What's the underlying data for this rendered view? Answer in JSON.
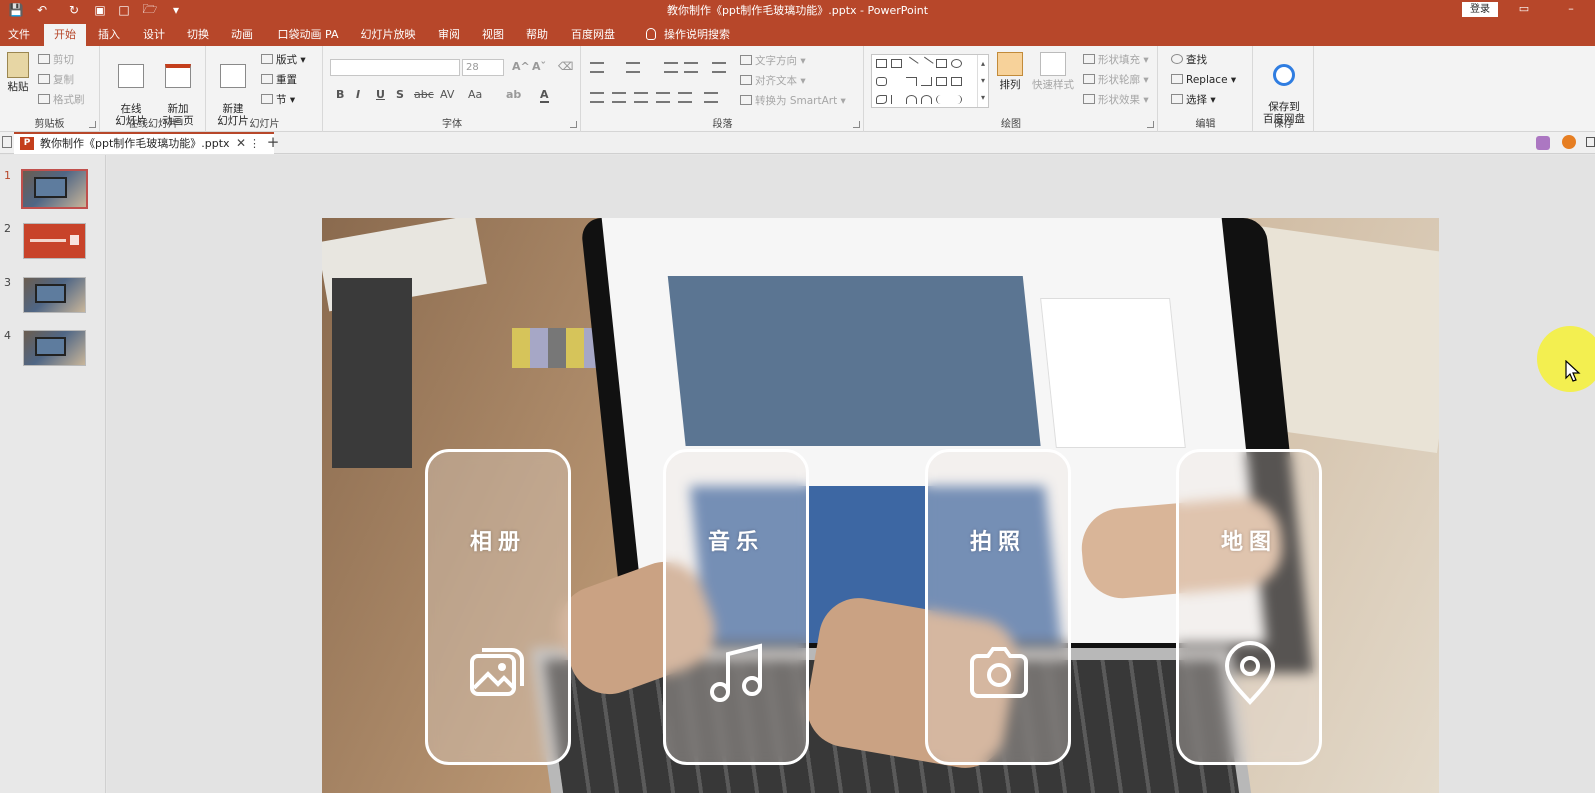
{
  "app": {
    "window_title": "教你制作《ppt制作毛玻璃功能》.pptx  -  PowerPoint",
    "login_label": "登录",
    "file_tab_label": "教你制作《ppt制作毛玻璃功能》.pptx"
  },
  "menu_tabs": [
    "文件",
    "开始",
    "插入",
    "设计",
    "切换",
    "动画",
    "口袋动画 PA",
    "幻灯片放映",
    "审阅",
    "视图",
    "帮助",
    "百度网盘",
    "操作说明搜索"
  ],
  "active_tab": "开始",
  "ribbon": {
    "clipboard": {
      "paste": "粘贴",
      "cut": "剪切",
      "copy": "复制",
      "format_painter": "格式刷",
      "group": "剪贴板"
    },
    "online_slides": {
      "online": "在线\n幻灯片",
      "new_anim": "新加\n动画页",
      "group": "在线幻灯片"
    },
    "slides": {
      "new_slide": "新建\n幻灯片",
      "layout": "版式",
      "reset": "重置",
      "section": "节",
      "group": "幻灯片"
    },
    "font": {
      "size": "28",
      "group": "字体",
      "bold": "B",
      "italic": "I",
      "underline": "U",
      "strike": "S",
      "shadow": "abc",
      "spacing": "AV",
      "case": "Aa",
      "color": "A"
    },
    "paragraph": {
      "text_direction": "文字方向",
      "align_text": "对齐文本",
      "smartart": "转换为 SmartArt",
      "group": "段落"
    },
    "drawing": {
      "arrange": "排列",
      "quick_styles": "快速样式",
      "fill": "形状填充",
      "outline": "形状轮廓",
      "effects": "形状效果",
      "group": "绘图"
    },
    "editing": {
      "find": "查找",
      "replace": "Replace",
      "select": "选择",
      "group": "编辑"
    },
    "save": {
      "label": "保存到\n百度网盘",
      "group": "保存"
    }
  },
  "thumbnails": [
    {
      "num": "1",
      "selected": true,
      "kind": "photo"
    },
    {
      "num": "2",
      "selected": false,
      "kind": "red"
    },
    {
      "num": "3",
      "selected": false,
      "kind": "photo"
    },
    {
      "num": "4",
      "selected": false,
      "kind": "photo"
    }
  ],
  "slide": {
    "cards": [
      {
        "title": "相册",
        "icon": "gallery-icon"
      },
      {
        "title": "音乐",
        "icon": "music-icon"
      },
      {
        "title": "拍照",
        "icon": "camera-icon"
      },
      {
        "title": "地图",
        "icon": "map-pin-icon"
      }
    ]
  },
  "colors": {
    "accent": "#b7472a",
    "ribbon_bg": "#f3f3f3",
    "pointer_halo": "#f4ef3f"
  }
}
